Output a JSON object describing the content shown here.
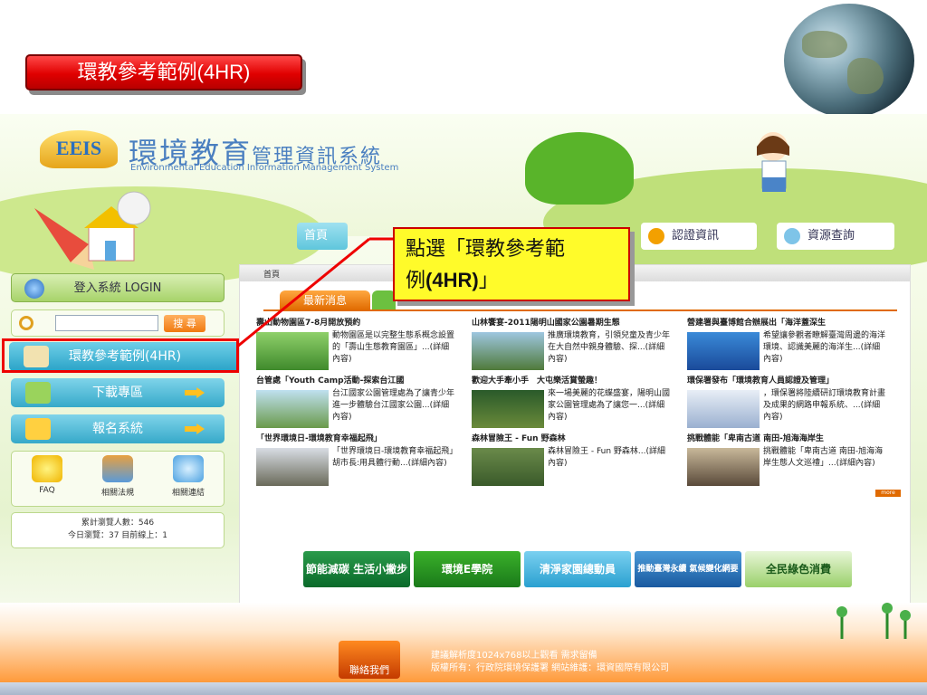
{
  "slide": {
    "title": "環教參考範例(4HR)"
  },
  "site": {
    "logo_text": "EEIS",
    "title_big": "環境教育",
    "title_small": "管理資訊系統",
    "subtitle": "Environmental Education Information Management System"
  },
  "nav": {
    "home": "首頁",
    "cert": "認證資訊",
    "resources": "資源查詢"
  },
  "left": {
    "login": "登入系統 LOGIN",
    "search_button": "搜 尋",
    "search_placeholder": "",
    "ref_examples": "環教參考範例(4HR)",
    "download": "下載專區",
    "register": "報名系統",
    "quick_links": [
      "FAQ",
      "相關法規",
      "相關連結"
    ],
    "visits_total": "累計瀏覽人數：546",
    "visits_today": "今日瀏覽：37 目前線上：1"
  },
  "callout": {
    "line1": "點選「環教參考範",
    "line2_pre": "例",
    "line2_bold": "(4HR)",
    "line2_post": "」"
  },
  "main": {
    "breadcrumb": "首頁",
    "tab_news": "最新消息",
    "more": "more",
    "news": [
      {
        "title": "壽山動物園區7-8月開放預約",
        "body": "動物園區是以完整生態系概念設置的「壽山生態教育園區」...(詳細內容)"
      },
      {
        "title": "山林饗宴-2011陽明山國家公園暑期生態",
        "body": "推廣環境教育，引領兒童及青少年在大自然中親身體驗、探...(詳細內容)"
      },
      {
        "title": "營建署與臺博館合辦展出「海洋蓋深生",
        "body": "希望讓參觀者瞭解臺灣周邊的海洋環境、認識美麗的海洋生...(詳細內容)"
      },
      {
        "title": "台管處「Youth Camp活動-探索台江國",
        "body": "台江國家公園管理處為了讓青少年進一步體驗台江國家公園...(詳細內容)"
      },
      {
        "title": "歡迎大手牽小手　大屯樂活賞螢趣！",
        "body": "來一場美麗的花蝶盛宴，陽明山國家公園管理處為了讓您一...(詳細內容)"
      },
      {
        "title": "環保署發布「環境教育人員認證及管理」",
        "body": "，環保署將陸續研訂環境教育計畫及成果的網路申報系統、...(詳細內容)"
      },
      {
        "title": "「世界環境日-環境教育幸福起飛」",
        "body": "「世界環境日-環境教育幸福起飛」胡市長:用具體行動...(詳細內容)"
      },
      {
        "title": "森林冒險王 - Fun 野森林",
        "body": "森林冒險王 - Fun 野森林...(詳細內容)"
      },
      {
        "title": "挑戰體能「卑南古道 南田-旭海海岸生",
        "body": "挑戰體能「卑南古道 南田-旭海海岸生態人文巡禮」...(詳細內容)"
      }
    ],
    "banners": [
      "節能減碳 生活小撇步",
      "環境E學院",
      "清淨家園總動員",
      "推動臺灣永續 氣候變化網要公約",
      "全民綠色消費"
    ]
  },
  "footer": {
    "contact": "聯絡我們",
    "line1": "建議解析度1024x768以上觀看 需求留備",
    "line2": "版權所有：行政院環境保護署 網站維護：環資國際有限公司"
  },
  "colors": {
    "accent_red": "#e00000",
    "callout_yellow": "#fffb2a",
    "nav_blue": "#2aa3c7",
    "news_orange": "#e06a00"
  }
}
